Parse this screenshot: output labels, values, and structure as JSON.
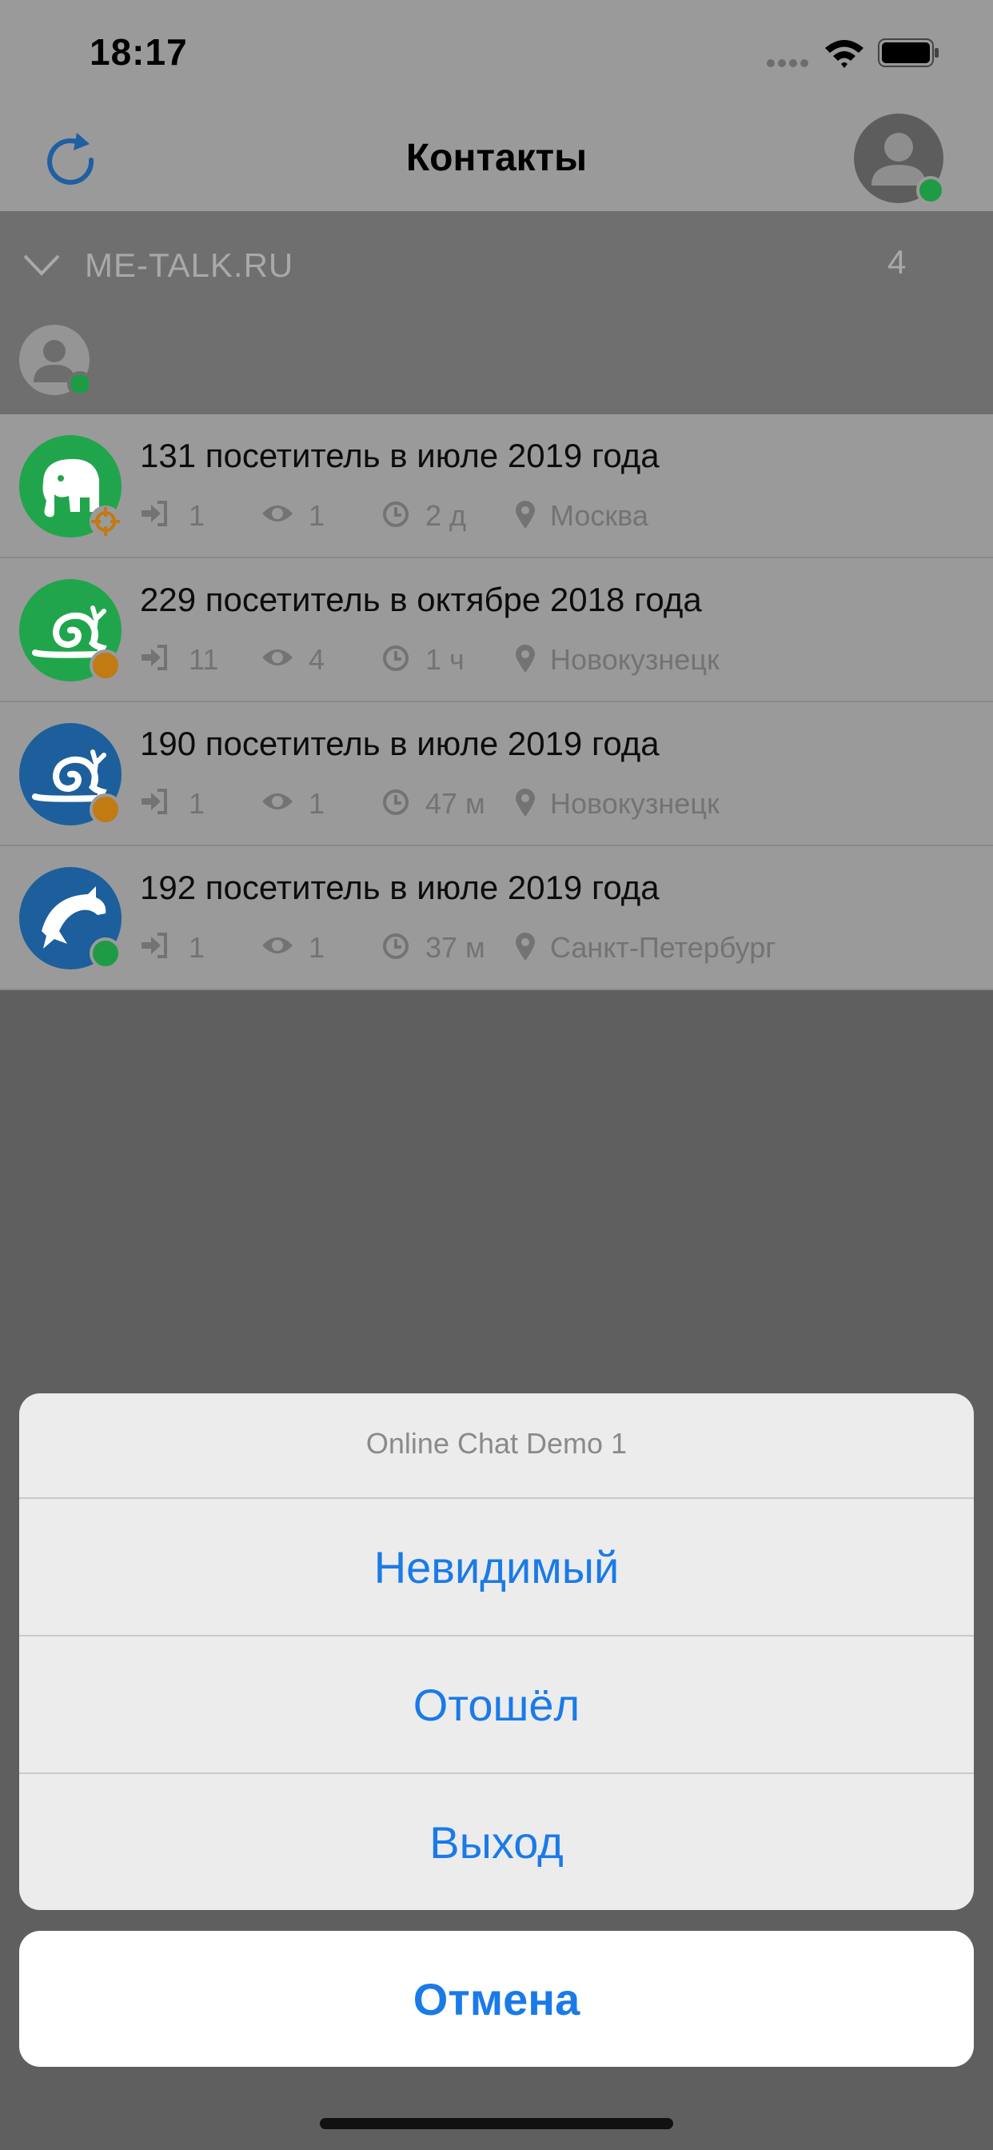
{
  "status_bar": {
    "time": "18:17"
  },
  "header": {
    "title": "Контакты"
  },
  "group": {
    "name": "ME-TALK.RU",
    "count": "4"
  },
  "contacts": [
    {
      "title": "131 посетитель в июле 2019 года",
      "logins": "1",
      "views": "1",
      "time": "2 д",
      "location": "Москва",
      "avatar": "elephant-icon",
      "avatar_color": "#21a54c",
      "status_color": "#c27a12"
    },
    {
      "title": "229 посетитель в октябре 2018 года",
      "logins": "11",
      "views": "4",
      "time": "1 ч",
      "location": "Новокузнецк",
      "avatar": "snail-icon",
      "avatar_color": "#21a54c",
      "status_color": "#c27a12"
    },
    {
      "title": "190 посетитель в июле 2019 года",
      "logins": "1",
      "views": "1",
      "time": "47 м",
      "location": "Новокузнецк",
      "avatar": "snail-icon",
      "avatar_color": "#1c5f9c",
      "status_color": "#c27a12"
    },
    {
      "title": "192 посетитель в июле 2019 года",
      "logins": "1",
      "views": "1",
      "time": "37 м",
      "location": "Санкт-Петербург",
      "avatar": "dolphin-icon",
      "avatar_color": "#1c5f9c",
      "status_color": "#1f9b45"
    }
  ],
  "action_sheet": {
    "title": "Online Chat Demo 1",
    "options": [
      "Невидимый",
      "Отошёл",
      "Выход"
    ],
    "cancel": "Отмена"
  },
  "colors": {
    "accent": "#1a7ae8",
    "online": "#1f9b45",
    "away": "#c27a12"
  }
}
